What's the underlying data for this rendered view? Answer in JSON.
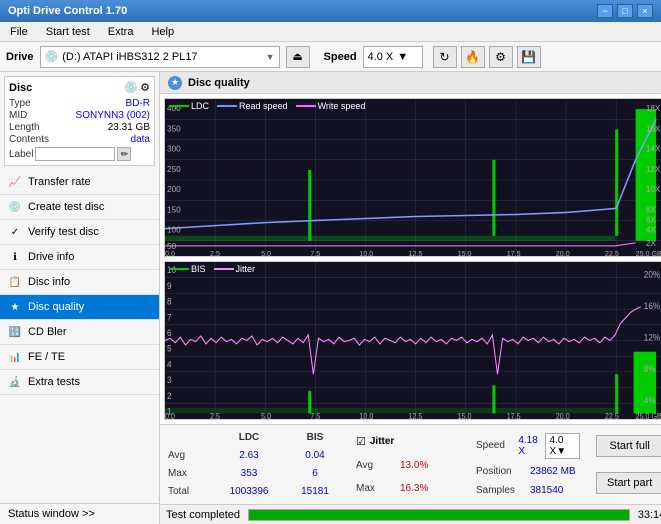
{
  "titleBar": {
    "title": "Opti Drive Control 1.70",
    "minimize": "−",
    "maximize": "□",
    "close": "×"
  },
  "menuBar": {
    "items": [
      "File",
      "Start test",
      "Extra",
      "Help"
    ]
  },
  "driveBar": {
    "driveLabel": "Drive",
    "driveValue": "(D:) ATAPI iHBS312 2 PL17",
    "speedLabel": "Speed",
    "speedValue": "4.0 X"
  },
  "disc": {
    "title": "Disc",
    "type_label": "Type",
    "type_value": "BD-R",
    "mid_label": "MID",
    "mid_value": "SONYNN3 (002)",
    "length_label": "Length",
    "length_value": "23.31 GB",
    "contents_label": "Contents",
    "contents_value": "data",
    "label_label": "Label"
  },
  "navItems": [
    {
      "id": "transfer-rate",
      "label": "Transfer rate",
      "icon": "📈"
    },
    {
      "id": "create-test-disc",
      "label": "Create test disc",
      "icon": "💿"
    },
    {
      "id": "verify-test-disc",
      "label": "Verify test disc",
      "icon": "✓"
    },
    {
      "id": "drive-info",
      "label": "Drive info",
      "icon": "ℹ"
    },
    {
      "id": "disc-info",
      "label": "Disc info",
      "icon": "📋"
    },
    {
      "id": "disc-quality",
      "label": "Disc quality",
      "icon": "★",
      "active": true
    },
    {
      "id": "cd-bler",
      "label": "CD Bler",
      "icon": "🔢"
    },
    {
      "id": "fe-te",
      "label": "FE / TE",
      "icon": "📊"
    },
    {
      "id": "extra-tests",
      "label": "Extra tests",
      "icon": "🔬"
    }
  ],
  "statusWindow": {
    "label": "Status window >>"
  },
  "discQuality": {
    "title": "Disc quality",
    "legend": {
      "ldc": "LDC",
      "readSpeed": "Read speed",
      "writeSpeed": "Write speed"
    },
    "legend2": {
      "bis": "BIS",
      "jitter": "Jitter"
    }
  },
  "stats": {
    "headers": [
      "LDC",
      "BIS"
    ],
    "rows": [
      {
        "label": "Avg",
        "ldc": "2.63",
        "bis": "0.04",
        "jitter": "13.0%"
      },
      {
        "label": "Max",
        "ldc": "353",
        "bis": "6",
        "jitter": "16.3%"
      },
      {
        "label": "Total",
        "ldc": "1003396",
        "bis": "15181",
        "jitter": ""
      }
    ],
    "jitter": {
      "label": "Jitter",
      "checked": true
    },
    "speed": {
      "label": "Speed",
      "value": "4.18 X",
      "selectValue": "4.0 X"
    },
    "position": {
      "label": "Position",
      "value": "23862 MB"
    },
    "samples": {
      "label": "Samples",
      "value": "381540"
    },
    "buttons": {
      "startFull": "Start full",
      "startPart": "Start part"
    }
  },
  "bottomStatus": {
    "text": "Test completed",
    "progress": 100,
    "time": "33:14"
  },
  "charts": {
    "top": {
      "yLeftLabels": [
        "400",
        "350",
        "300",
        "250",
        "200",
        "150",
        "100",
        "50",
        "0"
      ],
      "yRightLabels": [
        "18X",
        "16X",
        "14X",
        "12X",
        "10X",
        "8X",
        "6X",
        "4X",
        "2X"
      ],
      "xLabels": [
        "0.0",
        "2.5",
        "5.0",
        "7.5",
        "10.0",
        "12.5",
        "15.0",
        "17.5",
        "20.0",
        "22.5",
        "25.0 GB"
      ]
    },
    "bottom": {
      "yLeftLabels": [
        "10",
        "9",
        "8",
        "7",
        "6",
        "5",
        "4",
        "3",
        "2",
        "1"
      ],
      "yRightLabels": [
        "20%",
        "16%",
        "12%",
        "8%",
        "4%"
      ],
      "xLabels": [
        "0.0",
        "2.5",
        "5.0",
        "7.5",
        "10.0",
        "12.5",
        "15.0",
        "17.5",
        "20.0",
        "22.5",
        "25.0 GB"
      ]
    }
  }
}
